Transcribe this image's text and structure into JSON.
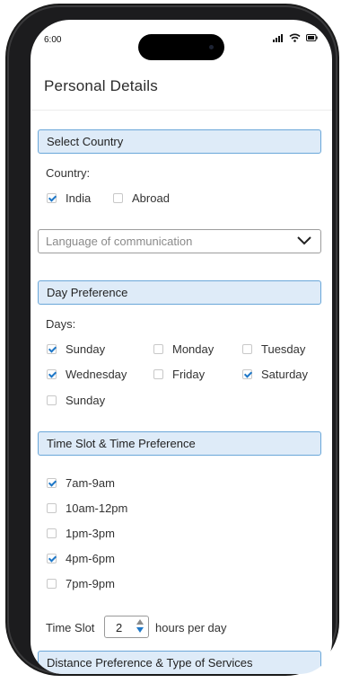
{
  "status_bar": {
    "time": "6:00"
  },
  "page": {
    "title": "Personal Details"
  },
  "country_section": {
    "header": "Select Country",
    "label": "Country:",
    "options": [
      {
        "label": "India",
        "checked": true
      },
      {
        "label": "Abroad",
        "checked": false
      }
    ]
  },
  "language": {
    "placeholder": "Language of communication"
  },
  "day_section": {
    "header": "Day Preference",
    "label": "Days:",
    "days": [
      {
        "label": "Sunday",
        "checked": true
      },
      {
        "label": "Monday",
        "checked": false
      },
      {
        "label": "Tuesday",
        "checked": false
      },
      {
        "label": "Wednesday",
        "checked": true
      },
      {
        "label": "Friday",
        "checked": false
      },
      {
        "label": "Saturday",
        "checked": true
      },
      {
        "label": "Sunday",
        "checked": false
      }
    ]
  },
  "time_section": {
    "header": "Time Slot & Time Preference",
    "slots": [
      {
        "label": "7am-9am",
        "checked": true
      },
      {
        "label": "10am-12pm",
        "checked": false
      },
      {
        "label": "1pm-3pm",
        "checked": false
      },
      {
        "label": "4pm-6pm",
        "checked": true
      },
      {
        "label": "7pm-9pm",
        "checked": false
      }
    ],
    "time_slot_label": "Time Slot",
    "time_slot_value": "2",
    "time_slot_suffix": "hours per day"
  },
  "distance_section": {
    "header": "Distance Preference & Type of Services"
  },
  "colors": {
    "accent": "#1f78c8",
    "header_bg": "#deebf8",
    "header_border": "#6aa7d9"
  },
  "icons": [
    "signal-icon",
    "wifi-icon",
    "battery-icon",
    "chevron-down-icon",
    "stepper-up-icon",
    "stepper-down-icon"
  ]
}
